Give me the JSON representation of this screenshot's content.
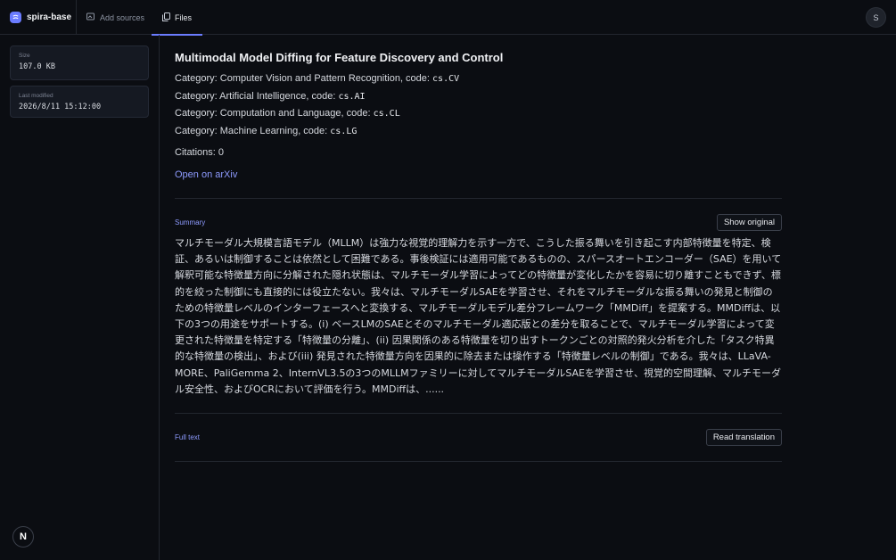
{
  "app": {
    "name": "spira-base",
    "user_initial": "S"
  },
  "nav": {
    "add_sources": "Add sources",
    "files": "Files"
  },
  "sidebar": {
    "size_label": "Size",
    "size_value": "107.0 KB",
    "modified_label": "Last modified",
    "modified_value": "2026/8/11 15:12:00"
  },
  "paper": {
    "title": "Multimodal Model Diffing for Feature Discovery and Control",
    "categories": [
      {
        "prefix": "Category: Computer Vision and Pattern Recognition, code: ",
        "code": "cs.CV"
      },
      {
        "prefix": "Category: Artificial Intelligence, code: ",
        "code": "cs.AI"
      },
      {
        "prefix": "Category: Computation and Language, code: ",
        "code": "cs.CL"
      },
      {
        "prefix": "Category: Machine Learning, code: ",
        "code": "cs.LG"
      }
    ],
    "citations": "Citations: 0",
    "arxiv_link": "Open on arXiv"
  },
  "summary": {
    "label": "Summary",
    "show_original": "Show original",
    "text": "マルチモーダル大規模言語モデル（MLLM）は強力な視覚的理解力を示す一方で、こうした振る舞いを引き起こす内部特徴量を特定、検証、あるいは制御することは依然として困難である。事後検証には適用可能であるものの、スパースオートエンコーダー（SAE）を用いて解釈可能な特徴量方向に分解された隠れ状態は、マルチモーダル学習によってどの特徴量が変化したかを容易に切り離すこともできず、標的を絞った制御にも直接的には役立たない。我々は、マルチモーダルSAEを学習させ、それをマルチモーダルな振る舞いの発見と制御のための特徴量レベルのインターフェースへと変換する、マルチモーダルモデル差分フレームワーク「MMDiff」を提案する。MMDiffは、以下の3つの用途をサポートする。(i) ベースLMのSAEとそのマルチモーダル適応版との差分を取ることで、マルチモーダル学習によって変更された特徴量を特定する「特徴量の分離」、(ii) 因果関係のある特徴量を切り出すトークンごとの対照的発火分析を介した「タスク特異的な特徴量の検出」、および(iii) 発見された特徴量方向を因果的に除去または操作する「特徴量レベルの制御」である。我々は、LLaVA-MORE、PaliGemma 2、InternVL3.5の3つのMLLMファミリーに対してマルチモーダルSAEを学習させ、視覚的空間理解、マルチモーダル安全性、およびOCRにおいて評価を行う。MMDiffは、......"
  },
  "fulltext": {
    "label": "Full text",
    "read_translation": "Read translation"
  },
  "colors": {
    "accent": "#6b7cff",
    "link": "#8e9bff",
    "background": "#0b0d12"
  },
  "icons": {
    "brand": "spira-logo-icon",
    "add_sources": "image-plus-icon",
    "files": "files-icon",
    "badge": "n-logo-icon"
  }
}
